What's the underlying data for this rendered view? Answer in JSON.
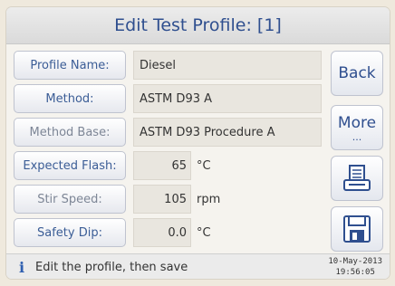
{
  "title": "Edit Test Profile: [1]",
  "fields": [
    {
      "label": "Profile Name:",
      "value": "Diesel",
      "unit": ""
    },
    {
      "label": "Method:",
      "value": "ASTM D93 A",
      "unit": ""
    },
    {
      "label": "Method Base:",
      "value": "ASTM D93 Procedure A",
      "unit": ""
    },
    {
      "label": "Expected Flash:",
      "value": "65",
      "unit": "°C"
    },
    {
      "label": "Stir Speed:",
      "value": "105",
      "unit": "rpm"
    },
    {
      "label": "Safety Dip:",
      "value": "0.0",
      "unit": "°C"
    }
  ],
  "side_buttons": {
    "back_label": "Back",
    "more_label": "More",
    "more_dots": "...",
    "print_icon": "printer-icon",
    "save_icon": "floppy-disk-icon"
  },
  "status": {
    "icon": "info-icon",
    "text": "Edit the profile, then save",
    "date": "10-May-2013",
    "time": "19:56:05"
  },
  "colors": {
    "accent": "#2f4f8f",
    "label_text": "#3b5d96"
  }
}
